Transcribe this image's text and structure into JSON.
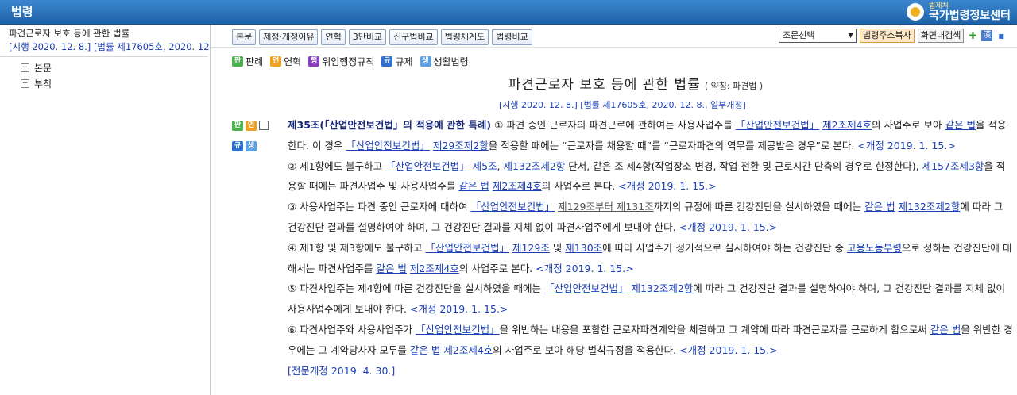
{
  "header": {
    "title": "법령",
    "logo_sub": "법제처",
    "logo_main": "국가법령정보센터"
  },
  "sidebar": {
    "law_name": "파견근로자 보호 등에 관한 법률",
    "law_meta": "[시행 2020. 12. 8.] [법률 제17605호, 2020. 12",
    "tree": [
      {
        "label": "본문"
      },
      {
        "label": "부칙"
      }
    ]
  },
  "toolbar": {
    "buttons": [
      "본문",
      "제정·개정이유",
      "연혁",
      "3단비교",
      "신구법비교",
      "법령체계도",
      "법령비교"
    ],
    "select_value": "조문선택",
    "copy_url": "법령주소복사",
    "search": "화면내검색"
  },
  "legend": [
    {
      "badge": "판",
      "label": "판례"
    },
    {
      "badge": "연",
      "label": "연혁"
    },
    {
      "badge": "행",
      "label": "위임행정규칙"
    },
    {
      "badge": "규",
      "label": "규제"
    },
    {
      "badge": "생",
      "label": "생활법령"
    }
  ],
  "law": {
    "title": "파견근로자 보호 등에 관한 법률",
    "abbr": "( 약칭: 파견법 )",
    "enforcement": "[시행 2020. 12. 8.] [법률 제17605호, 2020. 12. 8., 일부개정]"
  },
  "article": {
    "title": "제35조(「산업안전보건법」의 적용에 관한 특례)",
    "p1a": " ① 파견 중인 근로자의 파견근로에 관하여는 사용사업주를 ",
    "link_sanan": "「산업안전보건법」",
    "link_2_4": "제2조제4호",
    "p1b": "의 사업주로 보아 ",
    "link_same": "같은 법",
    "p1c": "을 적용한다. 이 경우 ",
    "link_29_2": "제29조제2항",
    "p1d": "을 적용할 때에는 “근로자를 채용할 때”를 “근로자파견의 역무를 제공받은 경우”로 본다. ",
    "rev1": "<개정 2019. 1. 15.>",
    "p2a": "② 제1항에도 불구하고 ",
    "link_5": "제5조",
    "link_132_2": "제132조제2항",
    "p2b": " 단서, 같은 조 제4항(작업장소 변경, 작업 전환 및 근로시간 단축의 경우로 한정한다), ",
    "link_157_3": "제157조제3항",
    "p2c": "을 적용할 때에는 파견사업주 및 사용사업주를 ",
    "p2d": "의 사업주로 본다. ",
    "rev2": "<개정 2019. 1. 15.>",
    "p3a": "③ 사용사업주는 파견 중인 근로자에 대하여 ",
    "link_129_131": "제129조부터 제131조",
    "p3b": "까지의 규정에 따른 건강진단을 실시하였을 때에는 ",
    "p3c": "에 따라 그 건강진단 결과를 설명하여야 하며, 그 건강진단 결과를 지체 없이 파견사업주에게 보내야 한다. ",
    "rev3": "<개정 2019. 1. 15.>",
    "p4a": "④ 제1항 및 제3항에도 불구하고 ",
    "link_129": "제129조",
    "p4b": " 및 ",
    "link_130": "제130조",
    "p4c": "에 따라 사업주가 정기적으로 실시하여야 하는 건강진단 중 ",
    "link_moel": "고용노동부령",
    "p4d": "으로 정하는 건강진단에 대해서는 파견사업주를 ",
    "p4e": "의 사업주로 본다. ",
    "rev4": "<개정 2019. 1. 15.>",
    "p5a": "⑤ 파견사업주는 제4항에 따른 건강진단을 실시하였을 때에는 ",
    "p5b": "에 따라 그 건강진단 결과를 설명하여야 하며, 그 건강진단 결과를 지체 없이 사용사업주에게 보내야 한다. ",
    "rev5": "<개정 2019. 1. 15.>",
    "p6a": "⑥ 파견사업주와 사용사업주가 ",
    "p6b": "을 위반하는 내용을 포함한 근로자파견계약을 체결하고 그 계약에 따라 파견근로자를 근로하게 함으로써 ",
    "p6c": "을 위반한 경우에는 그 계약당사자 모두를 ",
    "p6d": "의 사업주로 보아 해당 벌칙규정을 적용한다. ",
    "rev6": "<개정 2019. 1. 15.>",
    "full_rev": "[전문개정 2019. 4. 30.]"
  }
}
